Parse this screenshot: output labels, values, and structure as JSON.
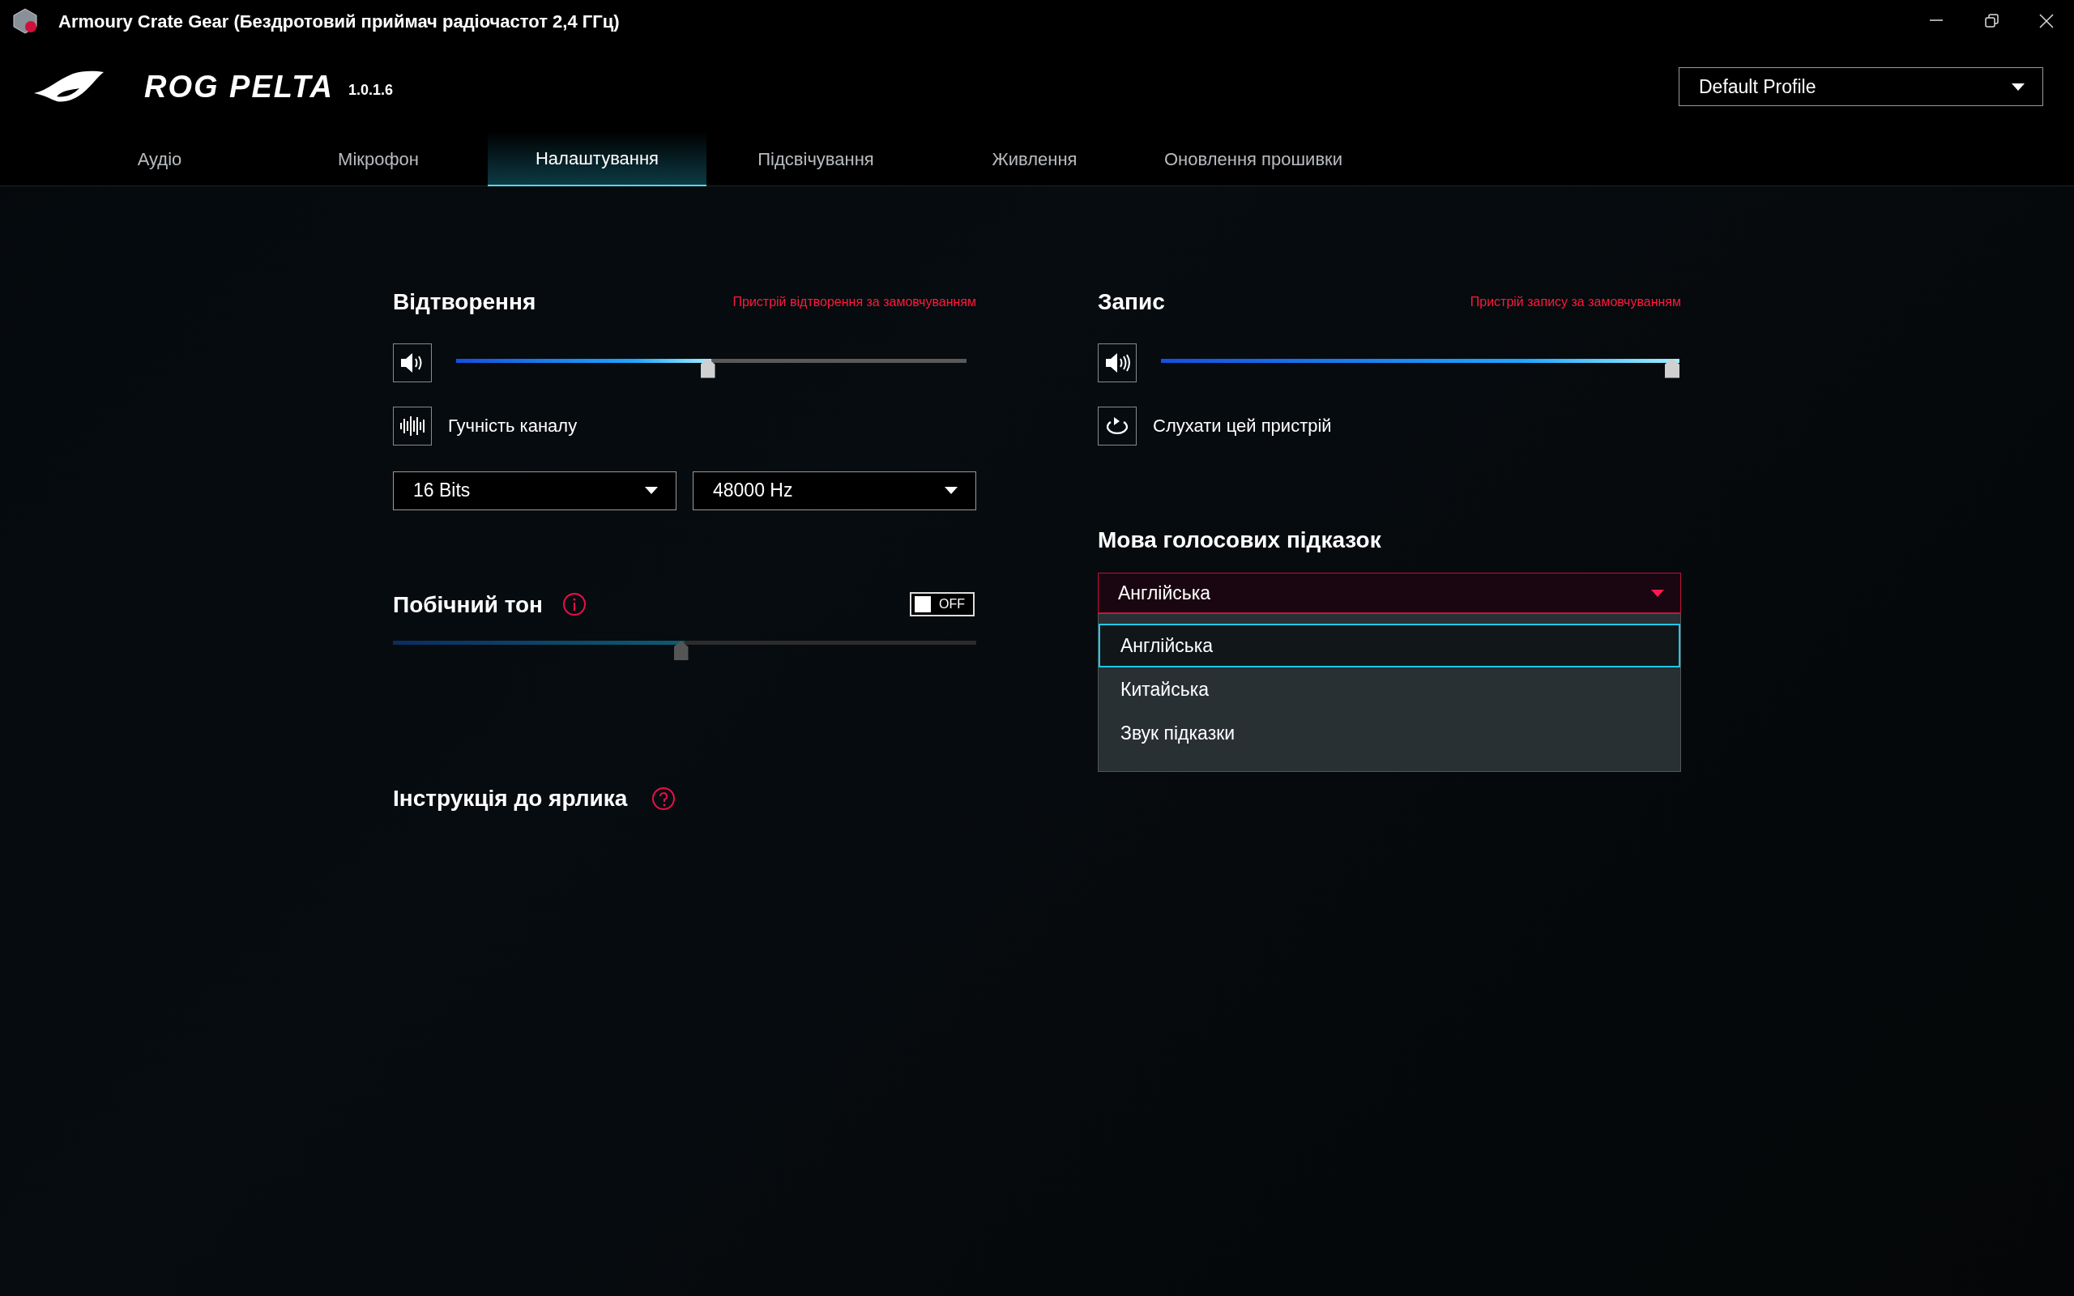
{
  "window": {
    "title": "Armoury Crate Gear (Бездротовий приймач радіочастот 2,4 ГГц)"
  },
  "header": {
    "product": "ROG PELTA",
    "version": "1.0.1.6",
    "profile": "Default Profile"
  },
  "tabs": [
    {
      "label": "Аудіо",
      "selected": false
    },
    {
      "label": "Мікрофон",
      "selected": false
    },
    {
      "label": "Налаштування",
      "selected": true
    },
    {
      "label": "Підсвічування",
      "selected": false
    },
    {
      "label": "Живлення",
      "selected": false
    },
    {
      "label": "Оновлення прошивки",
      "selected": false
    }
  ],
  "playback": {
    "title": "Відтворення",
    "device_note": "Пристрій відтворення за замовчуванням",
    "level": 0.5,
    "channel_volume": "Гучність каналу",
    "bit_depth": "16 Bits",
    "sample_rate": "48000 Hz"
  },
  "sidetone": {
    "title": "Побічний тон",
    "on": false,
    "toggle_label": "OFF",
    "level": 0.5
  },
  "shortcut": {
    "title": "Інструкція до ярлика"
  },
  "recording": {
    "title": "Запис",
    "device_note": "Пристрій запису за замовчуванням",
    "level": 1,
    "listen": "Слухати цей пристрій"
  },
  "voice_prompt": {
    "title": "Мова голосових підказок",
    "value": "Англійська",
    "expanded": true,
    "options": [
      {
        "label": "Англійська",
        "selected": true
      },
      {
        "label": "Китайська",
        "selected": false
      },
      {
        "label": "Звук підказки",
        "selected": false
      }
    ]
  }
}
